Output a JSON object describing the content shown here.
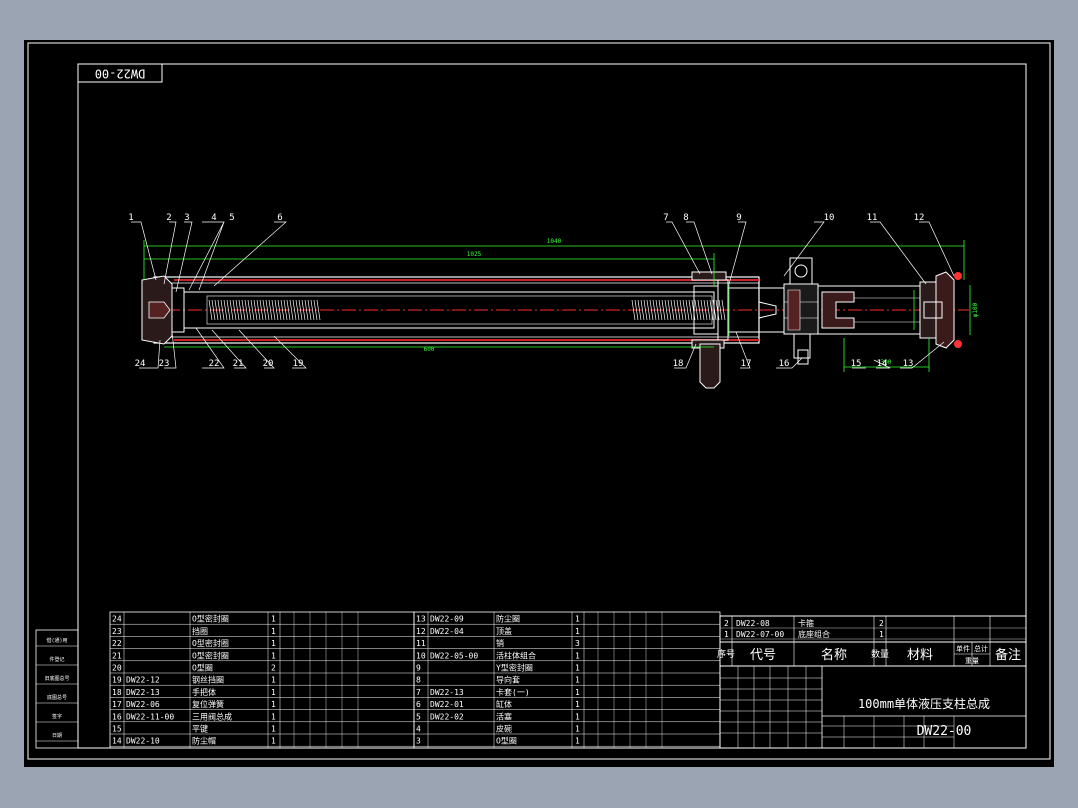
{
  "drawing": {
    "code_tag": "DW22-00",
    "title": "100mm单体液压支柱总成",
    "code": "DW22-00"
  },
  "callouts_top": [
    "1",
    "2",
    "3",
    "4",
    "5",
    "6",
    "7",
    "8",
    "9",
    "10",
    "11",
    "12"
  ],
  "callouts_bottom": [
    "24",
    "23",
    "22",
    "21",
    "20",
    "19",
    "18",
    "17",
    "16",
    "15",
    "14",
    "13"
  ],
  "dimensions": {
    "overall": "1040",
    "stroke": "1025",
    "inner": "600",
    "right_small": "300",
    "dia": "φ100"
  },
  "bom_left": [
    {
      "no": "24",
      "code": "",
      "name": "O型密封圈",
      "qty": "1"
    },
    {
      "no": "23",
      "code": "",
      "name": "挡圈",
      "qty": "1"
    },
    {
      "no": "22",
      "code": "",
      "name": "O型密封圈",
      "qty": "1"
    },
    {
      "no": "21",
      "code": "",
      "name": "O型密封圈",
      "qty": "1"
    },
    {
      "no": "20",
      "code": "",
      "name": "O型圈",
      "qty": "2"
    },
    {
      "no": "19",
      "code": "DW22-12",
      "name": "钢丝挡圈",
      "qty": "1"
    },
    {
      "no": "18",
      "code": "DW22-13",
      "name": "手把体",
      "qty": "1"
    },
    {
      "no": "17",
      "code": "DW22-06",
      "name": "复位弹簧",
      "qty": "1"
    },
    {
      "no": "16",
      "code": "DW22-11-00",
      "name": "三用阀总成",
      "qty": "1"
    },
    {
      "no": "15",
      "code": "",
      "name": "平键",
      "qty": "1"
    },
    {
      "no": "14",
      "code": "DW22-10",
      "name": "防尘帽",
      "qty": "1"
    }
  ],
  "bom_mid": [
    {
      "no": "13",
      "code": "DW22-09",
      "name": "防尘圈",
      "qty": "1"
    },
    {
      "no": "12",
      "code": "DW22-04",
      "name": "顶盖",
      "qty": "1"
    },
    {
      "no": "11",
      "code": "",
      "name": "销",
      "qty": "3"
    },
    {
      "no": "10",
      "code": "DW22-05-00",
      "name": "活柱体组合",
      "qty": "1"
    },
    {
      "no": "9",
      "code": "",
      "name": "Y型密封圈",
      "qty": "1"
    },
    {
      "no": "8",
      "code": "",
      "name": "导向套",
      "qty": "1"
    },
    {
      "no": "7",
      "code": "DW22-13",
      "name": "卡套(一)",
      "qty": "1"
    },
    {
      "no": "6",
      "code": "DW22-01",
      "name": "缸体",
      "qty": "1"
    },
    {
      "no": "5",
      "code": "DW22-02",
      "name": "活塞",
      "qty": "1"
    },
    {
      "no": "4",
      "code": "",
      "name": "皮碗",
      "qty": "1"
    },
    {
      "no": "3",
      "code": "",
      "name": "O型圈",
      "qty": "1"
    }
  ],
  "bom_right": [
    {
      "no": "2",
      "code": "DW22-08",
      "name": "卡箍",
      "qty": "2"
    },
    {
      "no": "1",
      "code": "DW22-07-00",
      "name": "底座组合",
      "qty": "1"
    }
  ],
  "header": {
    "no": "序号",
    "code": "代号",
    "name": "名称",
    "qty": "数量",
    "material": "材料",
    "single": "单件",
    "total": "总计",
    "weight": "重量",
    "remark": "备注"
  },
  "side_labels": [
    "借(通)用",
    "件登记",
    "旧底图总号",
    "底图总号",
    "签字",
    "日期"
  ],
  "colors": {
    "background": "#000000",
    "line": "#ffffff",
    "dimension": "#33ff33",
    "centerline": "#ff2a2a"
  }
}
